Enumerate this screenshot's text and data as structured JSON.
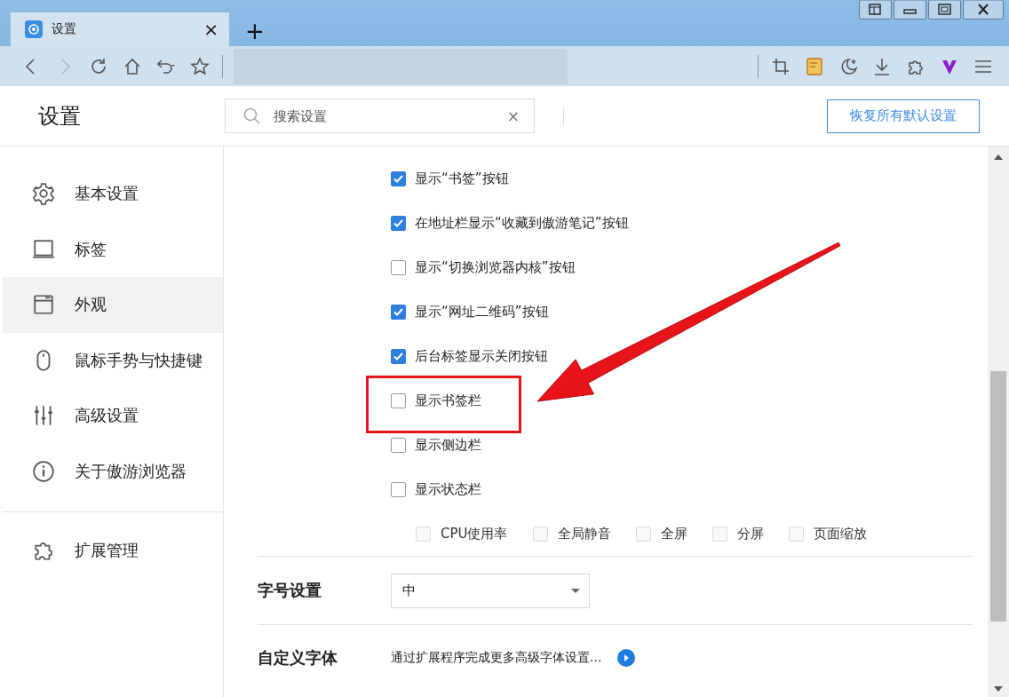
{
  "browser": {
    "tabs": [
      {
        "title": "设置",
        "close": "×",
        "selected": true
      }
    ],
    "new_tab": "+"
  },
  "page": {
    "title": "设置",
    "search": {
      "placeholder": "搜索设置",
      "clear": "×"
    },
    "restore_button": "恢复所有默认设置"
  },
  "sidebar": {
    "items": [
      {
        "label": "基本设置",
        "selected": false
      },
      {
        "label": "标签",
        "selected": false
      },
      {
        "label": "外观",
        "selected": true
      },
      {
        "label": "鼠标手势与快捷键",
        "selected": false
      },
      {
        "label": "高级设置",
        "selected": false
      },
      {
        "label": "关于傲游浏览器",
        "selected": false
      }
    ],
    "extensions": {
      "label": "扩展管理",
      "selected": false
    }
  },
  "options": [
    {
      "label": "显示“书签”按钮",
      "checked": true,
      "highlighted": false
    },
    {
      "label": "在地址栏显示“收藏到傲游笔记”按钮",
      "checked": true,
      "highlighted": false
    },
    {
      "label": "显示“切换浏览器内核”按钮",
      "checked": false,
      "highlighted": false
    },
    {
      "label": "显示“网址二维码”按钮",
      "checked": true,
      "highlighted": false
    },
    {
      "label": "后台标签显示关闭按钮",
      "checked": true,
      "highlighted": false
    },
    {
      "label": "显示书签栏",
      "checked": false,
      "highlighted": true
    },
    {
      "label": "显示侧边栏",
      "checked": false,
      "highlighted": false
    },
    {
      "label": "显示状态栏",
      "checked": false,
      "highlighted": false
    }
  ],
  "status_items": [
    {
      "label": "CPU使用率",
      "checked": false,
      "disabled": true
    },
    {
      "label": "全局静音",
      "checked": false,
      "disabled": true
    },
    {
      "label": "全屏",
      "checked": false,
      "disabled": true
    },
    {
      "label": "分屏",
      "checked": false,
      "disabled": true
    },
    {
      "label": "页面缩放",
      "checked": false,
      "disabled": true
    }
  ],
  "font_size": {
    "label": "字号设置",
    "value": "中"
  },
  "custom_font": {
    "label": "自定义字体",
    "text": "通过扩展程序完成更多高级字体设置..."
  },
  "annotations": [
    {
      "kind": "arrow"
    }
  ]
}
